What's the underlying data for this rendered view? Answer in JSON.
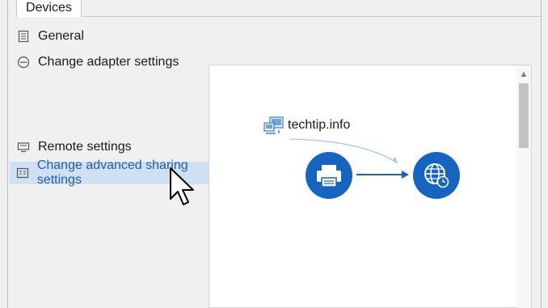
{
  "tabs": [
    {
      "label": "Devices"
    }
  ],
  "nav": {
    "items": [
      {
        "label": "General",
        "icon": "document-icon"
      },
      {
        "label": "Change adapter settings",
        "icon": "adapter-icon"
      },
      {
        "label": "Remote settings",
        "icon": "remote-icon"
      },
      {
        "label": "Change advanced sharing settings",
        "icon": "sharing-icon",
        "selected": true
      }
    ]
  },
  "diagram": {
    "site_label": "techtip.info",
    "nodes": [
      "printer-icon",
      "globe-clock-icon"
    ]
  },
  "colors": {
    "accent": "#1565c0",
    "selected_bg": "#cfe0f3",
    "selected_text": "#1f5fa8"
  }
}
